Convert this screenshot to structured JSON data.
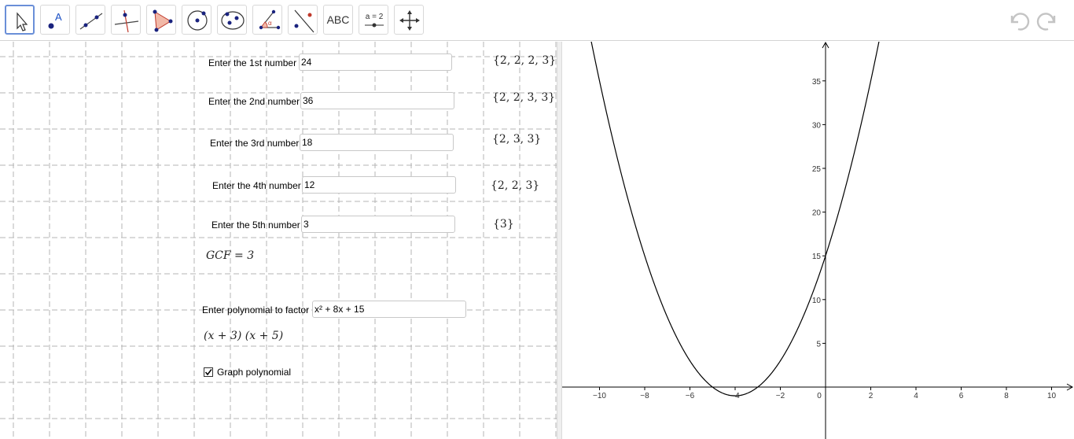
{
  "toolbar": {
    "tools": [
      {
        "name": "move-tool",
        "icon": "arrow-pointer-icon",
        "selected": true
      },
      {
        "name": "point-tool",
        "icon": "point-icon"
      },
      {
        "name": "line-tool",
        "icon": "line-icon"
      },
      {
        "name": "perpendicular-line-tool",
        "icon": "perpendicular-icon"
      },
      {
        "name": "polygon-tool",
        "icon": "polygon-icon"
      },
      {
        "name": "circle-tool",
        "icon": "circle-icon"
      },
      {
        "name": "ellipse-tool",
        "icon": "ellipse-icon"
      },
      {
        "name": "angle-tool",
        "icon": "angle-icon"
      },
      {
        "name": "reflect-tool",
        "icon": "reflect-icon"
      },
      {
        "name": "text-tool",
        "icon": "text-icon",
        "label": "ABC"
      },
      {
        "name": "slider-tool",
        "icon": "slider-icon",
        "label": "a = 2"
      },
      {
        "name": "move-graphics-view-tool",
        "icon": "move-arrows-icon"
      }
    ],
    "undo_icon": "undo-icon",
    "redo_icon": "redo-icon"
  },
  "form": {
    "numbers": [
      {
        "label": "Enter the 1st number",
        "value": "24",
        "factors": "{2, 2, 2, 3}"
      },
      {
        "label": "Enter the 2nd number",
        "value": "36",
        "factors": "{2, 2, 3, 3}"
      },
      {
        "label": "Enter the 3rd number",
        "value": "18",
        "factors": "{2, 3, 3}"
      },
      {
        "label": "Enter the 4th number",
        "value": "12",
        "factors": "{2, 2, 3}"
      },
      {
        "label": "Enter the 5th number",
        "value": "3",
        "factors": "{3}"
      }
    ],
    "gcf_text": "GCF = 3",
    "polynomial_label": "Enter polynomial to factor",
    "polynomial_value": "x² + 8x + 15",
    "factored_text": "(x + 3)  (x + 5)",
    "graph_checkbox_label": "Graph polynomial",
    "graph_checked": true
  },
  "graph": {
    "function": "x^2 + 8x + 15",
    "x_ticks": [
      "−10",
      "−8",
      "−6",
      "−4",
      "−2",
      "0",
      "2",
      "4",
      "6",
      "8",
      "10"
    ],
    "y_ticks": [
      "5",
      "10",
      "15",
      "20",
      "25",
      "30",
      "35"
    ],
    "curve_color": "#000000"
  }
}
